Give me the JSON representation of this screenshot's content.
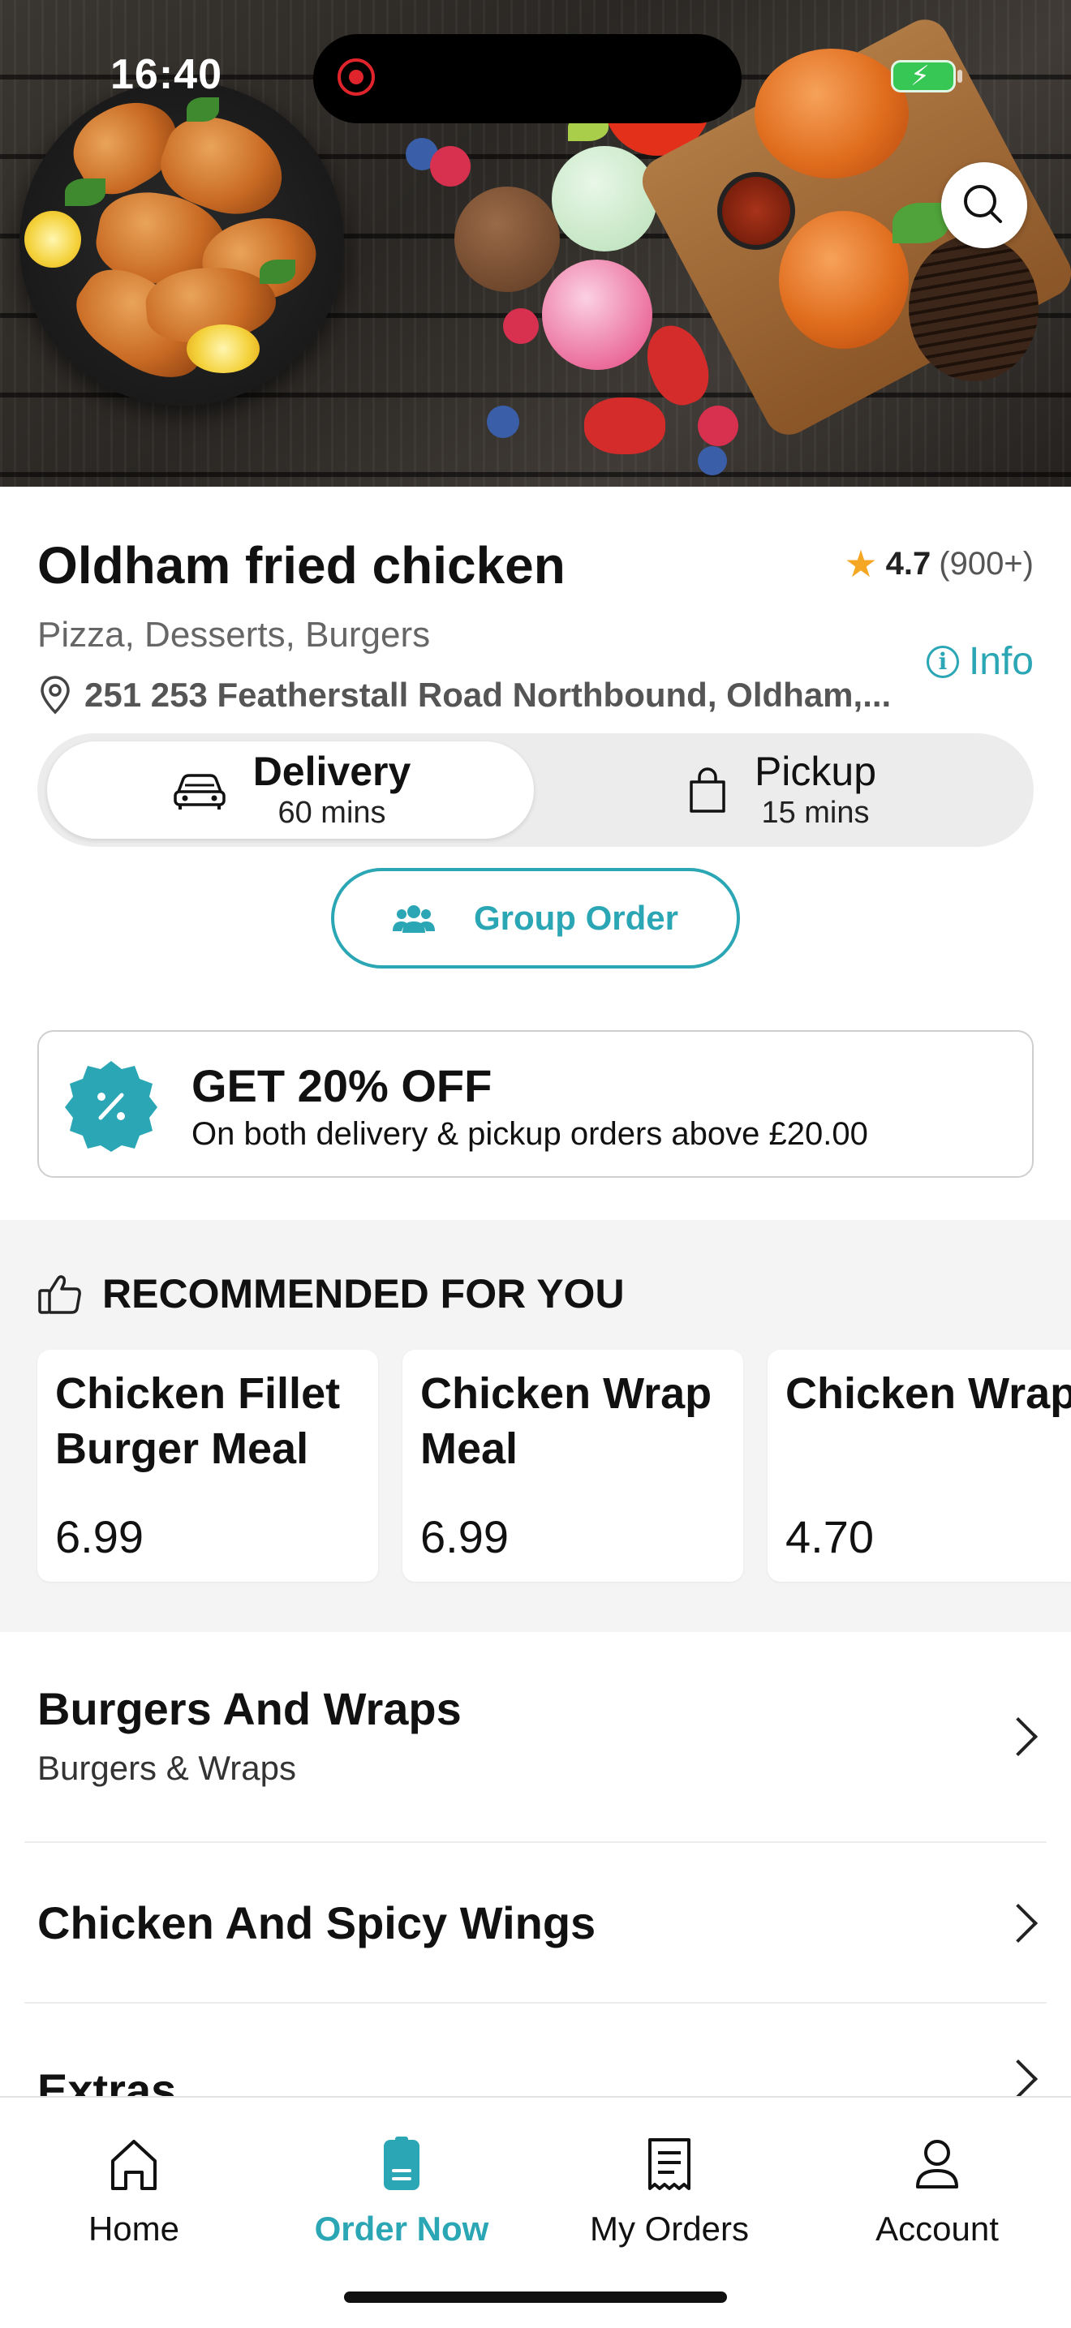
{
  "status_bar": {
    "time": "16:40"
  },
  "restaurant": {
    "name": "Oldham fried chicken",
    "rating": "4.7",
    "rating_count": "(900+)",
    "cuisines": "Pizza, Desserts, Burgers",
    "info_label": "Info",
    "address": "251  253 Featherstall Road Northbound, Oldham,..."
  },
  "order_mode": {
    "delivery": {
      "label": "Delivery",
      "time": "60 mins",
      "selected": true
    },
    "pickup": {
      "label": "Pickup",
      "time": "15 mins",
      "selected": false
    }
  },
  "group_order": {
    "label": "Group Order"
  },
  "promo": {
    "title": "GET 20% OFF",
    "subtitle": "On both delivery & pickup orders above £20.00"
  },
  "recommended": {
    "heading": "RECOMMENDED FOR YOU",
    "items": [
      {
        "name": "Chicken Fillet\nBurger Meal",
        "price": "6.99"
      },
      {
        "name": "Chicken Wrap\nMeal",
        "price": "6.99"
      },
      {
        "name": "Chicken Wrap",
        "price": "4.70"
      }
    ]
  },
  "categories": [
    {
      "name": "Burgers And Wraps",
      "subtitle": "Burgers & Wraps"
    },
    {
      "name": "Chicken And Spicy Wings",
      "subtitle": ""
    },
    {
      "name": "Extras",
      "subtitle": ""
    }
  ],
  "tab_bar": {
    "tabs": [
      {
        "label": "Home",
        "icon": "home-icon",
        "active": false
      },
      {
        "label": "Order Now",
        "icon": "order-icon",
        "active": true
      },
      {
        "label": "My Orders",
        "icon": "receipt-icon",
        "active": false
      },
      {
        "label": "Account",
        "icon": "person-icon",
        "active": false
      }
    ]
  },
  "colors": {
    "accent": "#2aa6b5",
    "star": "#f5a623",
    "text": "#111111",
    "section_bg": "#f4f4f4"
  }
}
